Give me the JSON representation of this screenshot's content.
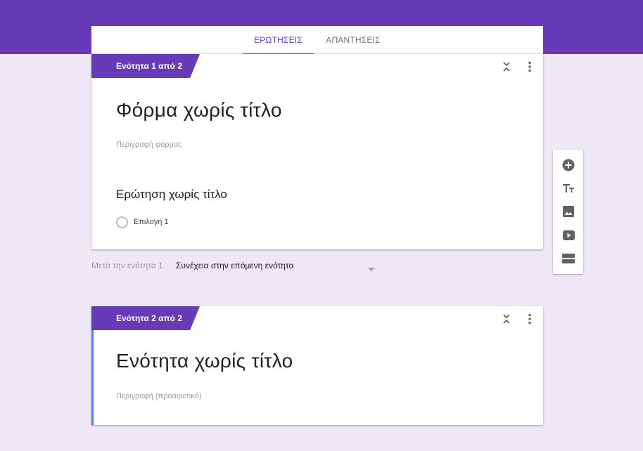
{
  "tabs": {
    "questions": "ΕΡΩΤΗΣΕΙΣ",
    "responses": "ΑΠΑΝΤΗΣΕΙΣ"
  },
  "section1": {
    "tag": "Ενότητα 1 από 2",
    "form_title": "Φόρμα χωρίς τίτλο",
    "form_description_placeholder": "Περιγραφή φόρμας",
    "question_title": "Ερώτηση χωρίς τίτλο",
    "option_label": "Επιλογή 1"
  },
  "after_section": {
    "label": "Μετά την ενότητα 1",
    "value": "Συνέχεια στην επόμενη ενότητα"
  },
  "section2": {
    "tag": "Ενότητα 2 από 2",
    "title": "Ενότητα χωρίς τίτλο",
    "description_placeholder": "Περιγραφή (προαιρετικό)"
  },
  "toolbar": {
    "icons": [
      "add-question-icon",
      "add-title-icon",
      "add-image-icon",
      "add-video-icon",
      "add-section-icon"
    ]
  },
  "colors": {
    "brand": "#673ab7",
    "background": "#ede7f6",
    "focus": "#4285f4"
  }
}
